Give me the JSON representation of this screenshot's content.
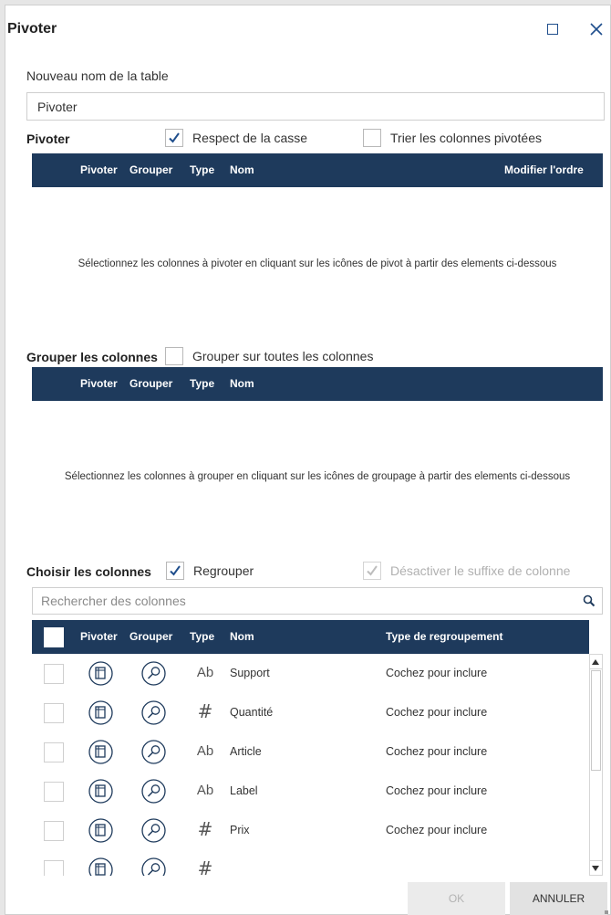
{
  "dialog": {
    "title": "Pivoter",
    "icons": {
      "maximize": "maximize-icon",
      "close": "close-icon"
    }
  },
  "new_name": {
    "label": "Nouveau nom de la table",
    "value": "Pivoter"
  },
  "pivot_section": {
    "label": "Pivoter",
    "case_sensitive": {
      "label": "Respect de la casse",
      "checked": true
    },
    "sort_pivoted": {
      "label": "Trier les colonnes pivotées",
      "checked": false
    },
    "headers": {
      "pivot": "Pivoter",
      "group": "Grouper",
      "type": "Type",
      "name": "Nom",
      "reorder": "Modifier l'ordre"
    },
    "empty_message": "Sélectionnez les colonnes à pivoter en cliquant sur les icônes de pivot à partir des elements ci-dessous"
  },
  "group_section": {
    "label": "Grouper les colonnes",
    "group_all": {
      "label": "Grouper sur toutes les colonnes",
      "checked": false
    },
    "headers": {
      "pivot": "Pivoter",
      "group": "Grouper",
      "type": "Type",
      "name": "Nom"
    },
    "empty_message": "Sélectionnez les colonnes à grouper en cliquant sur les icônes de groupage à partir des elements ci-dessous"
  },
  "choose_section": {
    "label": "Choisir les colonnes",
    "regroup": {
      "label": "Regrouper",
      "checked": true
    },
    "disable_suffix": {
      "label": "Désactiver le suffixe de colonne",
      "checked": true,
      "disabled": true
    },
    "search_placeholder": "Rechercher des colonnes",
    "headers": {
      "pivot": "Pivoter",
      "group": "Grouper",
      "type": "Type",
      "name": "Nom",
      "group_type": "Type de regroupement"
    },
    "rows": [
      {
        "type": "Ab",
        "name": "Support",
        "group_type": "Cochez pour inclure"
      },
      {
        "type": "#",
        "name": "Quantité",
        "group_type": "Cochez pour inclure"
      },
      {
        "type": "Ab",
        "name": "Article",
        "group_type": "Cochez pour inclure"
      },
      {
        "type": "Ab",
        "name": "Label",
        "group_type": "Cochez pour inclure"
      },
      {
        "type": "#",
        "name": "Prix",
        "group_type": "Cochez pour inclure"
      },
      {
        "type": "#",
        "name": "",
        "group_type": ""
      }
    ]
  },
  "footer": {
    "ok": "OK",
    "cancel": "ANNULER"
  },
  "colors": {
    "header_bg": "#1e3a5c",
    "accent": "#1f4e8c",
    "icon": "#1e3a5c"
  }
}
